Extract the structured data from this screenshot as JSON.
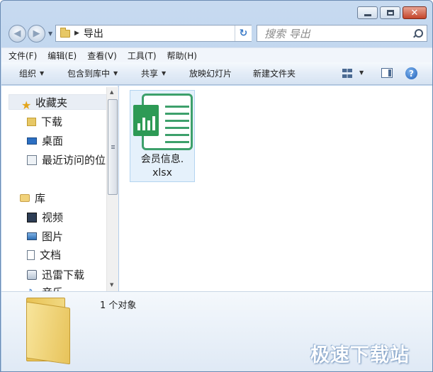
{
  "window": {
    "caption_min": "minimize",
    "caption_max": "maximize",
    "caption_close": "✕"
  },
  "address": {
    "path_segment": "导出"
  },
  "search": {
    "placeholder": "搜索 导出"
  },
  "menubar": {
    "items": [
      "文件(F)",
      "编辑(E)",
      "查看(V)",
      "工具(T)",
      "帮助(H)"
    ]
  },
  "commandbar": {
    "organize": "组织",
    "include_in_library": "包含到库中",
    "share": "共享",
    "slideshow": "放映幻灯片",
    "new_folder": "新建文件夹",
    "help_glyph": "?"
  },
  "navpane": {
    "favorites": "收藏夹",
    "downloads": "下载",
    "desktop": "桌面",
    "recent": "最近访问的位置",
    "libraries": "库",
    "videos": "视频",
    "pictures": "图片",
    "documents": "文档",
    "thunder": "迅雷下载",
    "music": "音乐"
  },
  "content": {
    "files": [
      {
        "name_line1": "会员信息.",
        "name_line2": "xlsx",
        "icon": "excel-file-icon"
      }
    ]
  },
  "details": {
    "count_text": "1 个对象"
  },
  "watermark": {
    "text": "极速下载站"
  },
  "colors": {
    "accent": "#2d9a55",
    "selection": "#e5f1fb",
    "chrome": "#b9d1ec"
  }
}
